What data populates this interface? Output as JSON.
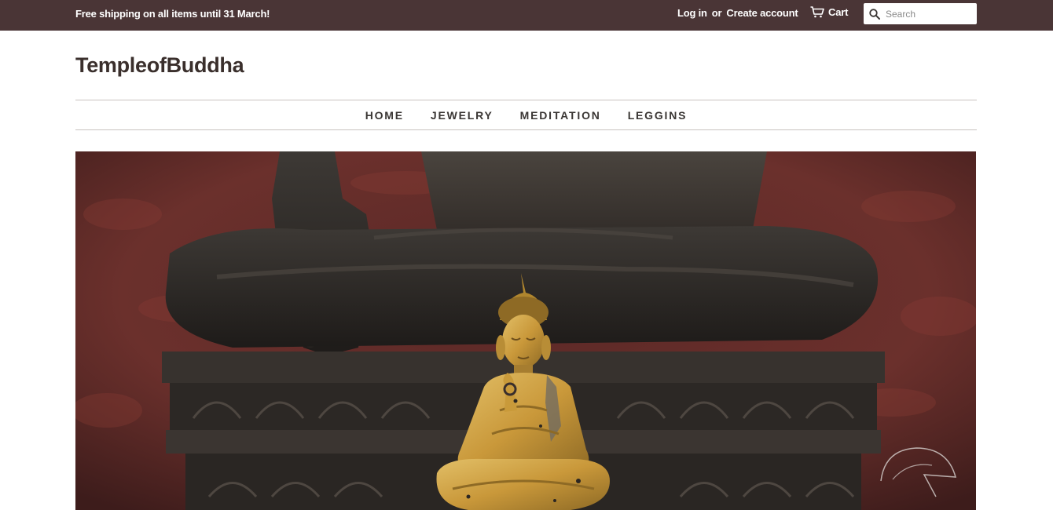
{
  "topbar": {
    "announcement": "Free shipping on all items until 31 March!",
    "login_label": "Log in",
    "or_label": "or",
    "create_account_label": "Create account",
    "cart_label": "Cart",
    "cart_icon": "cart-icon",
    "search_icon": "search-icon",
    "search_placeholder": "Search",
    "search_value": ""
  },
  "site": {
    "logo": "TempleofBuddha"
  },
  "nav": {
    "items": [
      {
        "label": "HOME"
      },
      {
        "label": "JEWELRY"
      },
      {
        "label": "MEDITATION"
      },
      {
        "label": "LEGGINS"
      }
    ]
  },
  "hero": {
    "subject": "buddha-statue-photo"
  },
  "colors": {
    "topbar_bg": "#4a3536",
    "text_dark": "#3a3634",
    "divider": "#c9c3c0",
    "hero_background_red": "#6b2e2a",
    "stone_dark": "#2e2a27",
    "gold": "#c99a3a"
  }
}
